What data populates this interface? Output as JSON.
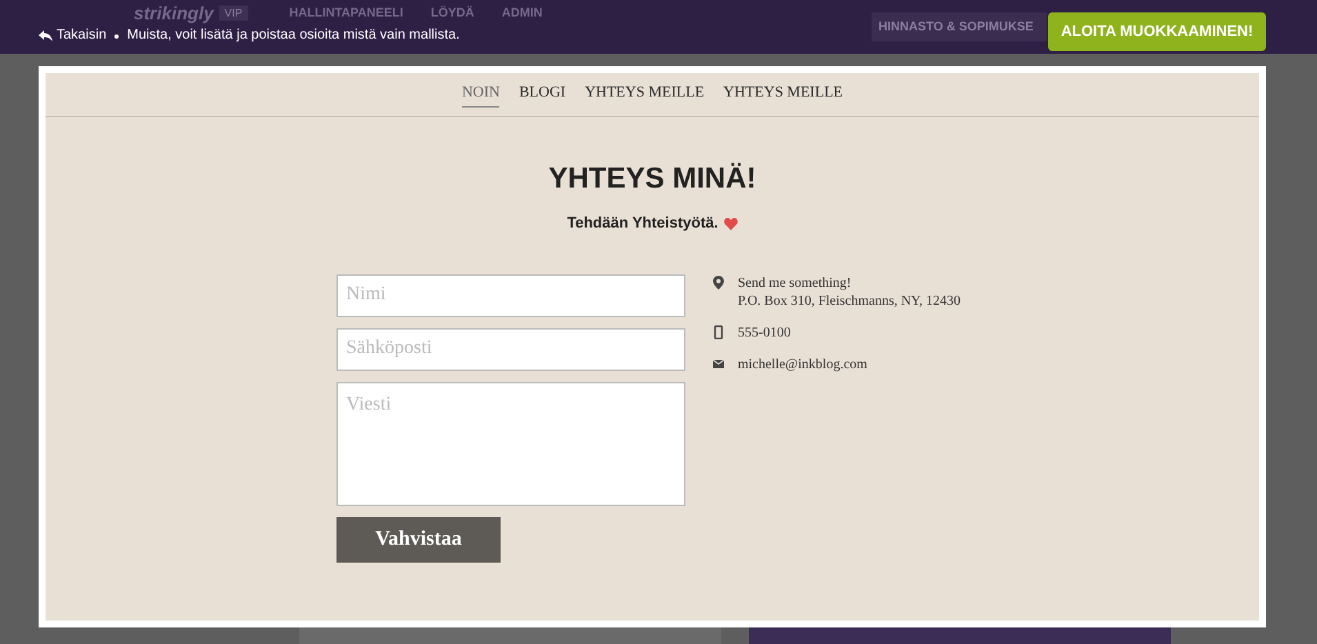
{
  "topbar": {
    "logo": "strikingly",
    "badge": "VIP",
    "nav": [
      "HALLINTAPANEELI",
      "LÖYDÄ",
      "ADMIN"
    ],
    "pricing": "HINNASTO & SOPIMUKSE",
    "back": "Takaisin",
    "notice": "Muista, voit lisätä ja poistaa osioita mistä vain mallista.",
    "cta": "ALOITA MUOKKAAMINEN!"
  },
  "site_nav": [
    {
      "label": "NOIN",
      "selected": true
    },
    {
      "label": "BLOGI",
      "selected": false
    },
    {
      "label": "YHTEYS MEILLE",
      "selected": false
    },
    {
      "label": "YHTEYS MEILLE",
      "selected": false
    }
  ],
  "heading": "YHTEYS MINÄ!",
  "subheading": "Tehdään Yhteistyötä.",
  "form": {
    "fields": [
      {
        "kind": "line",
        "placeholder": "Nimi"
      },
      {
        "kind": "line",
        "placeholder": "Sähköposti"
      },
      {
        "kind": "area",
        "placeholder": "Viesti"
      }
    ],
    "submit": "Vahvistaa"
  },
  "contact": [
    {
      "kind": "location",
      "lines": [
        "Send me something!",
        "P.O. Box 310, Fleischmanns, NY, 12430"
      ]
    },
    {
      "kind": "phone",
      "lines": [
        "555-0100"
      ]
    },
    {
      "kind": "email",
      "lines": [
        "michelle@inkblog.com"
      ]
    }
  ]
}
